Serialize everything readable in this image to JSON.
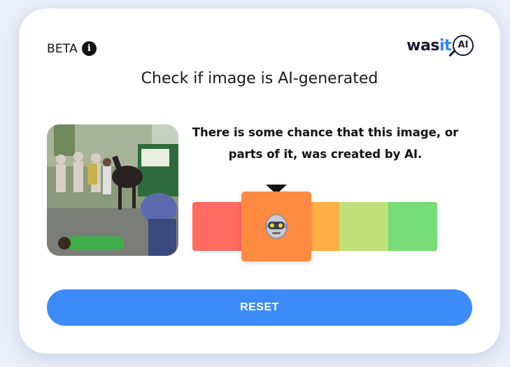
{
  "header": {
    "beta_label": "BETA",
    "info_icon": "info-icon",
    "logo": {
      "part1": "was",
      "part2": "it",
      "part3": "AI"
    }
  },
  "title": "Check if image is AI-generated",
  "result": {
    "verdict": "There is some chance that this image, or parts of it, was created by AI.",
    "scale_colors": [
      "#ff6a61",
      "#ff8a42",
      "#ffae45",
      "#bfe07a",
      "#75dc76"
    ],
    "active_level_index": 1,
    "active_icon": "robot-icon"
  },
  "actions": {
    "reset_label": "RESET"
  },
  "colors": {
    "accent": "#3d8bf7",
    "logo_blue": "#2f86f6"
  }
}
